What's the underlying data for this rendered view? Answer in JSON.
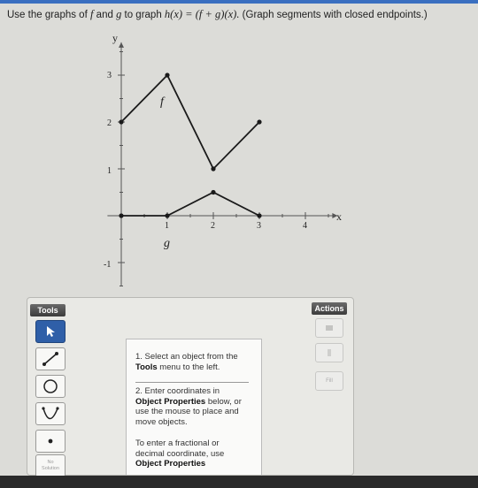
{
  "question": {
    "prefix": "Use the graphs of",
    "f": "f",
    "and": "and",
    "g": "g",
    "to_graph": "to graph",
    "formula": "h(x) = (f + g)(x).",
    "suffix": "(Graph segments with closed endpoints.)"
  },
  "graph": {
    "x_axis_label": "x",
    "y_axis_label": "y",
    "x_ticks": [
      "1",
      "2",
      "3",
      "4"
    ],
    "y_ticks": [
      "3",
      "2",
      "1",
      "-1"
    ],
    "f_label": "f",
    "g_label": "g",
    "f_points": [
      [
        0,
        2
      ],
      [
        1,
        3
      ],
      [
        2,
        1
      ],
      [
        3,
        2
      ]
    ],
    "g_points": [
      [
        0,
        0
      ],
      [
        1,
        0
      ],
      [
        2,
        0.5
      ],
      [
        3,
        0
      ]
    ],
    "x_range": [
      -0.3,
      4.7
    ],
    "y_range": [
      -1.5,
      3.7
    ]
  },
  "tools": {
    "header": "Tools",
    "items": [
      {
        "name": "pointer-tool",
        "icon": "arrow-pointer-icon",
        "selected": true
      },
      {
        "name": "segment-tool",
        "icon": "line-segment-icon"
      },
      {
        "name": "circle-tool",
        "icon": "circle-icon"
      },
      {
        "name": "parabola-tool",
        "icon": "parabola-icon"
      },
      {
        "name": "point-tool",
        "icon": "point-icon"
      }
    ],
    "no_solution_line1": "No",
    "no_solution_line2": "Solution"
  },
  "instructions": {
    "step1_text": "1. Select an object from the",
    "step1_bold": "Tools",
    "step1_end": "menu to the left.",
    "step2_start": "2. Enter coordinates in",
    "step2_bold": "Object Properties",
    "step2_end": "below, or use the mouse to place and move objects.",
    "note_text": "To enter a fractional or decimal coordinate, use",
    "note_bold": "Object Properties"
  },
  "actions": {
    "header": "Actions",
    "fill_label": "Fill"
  }
}
